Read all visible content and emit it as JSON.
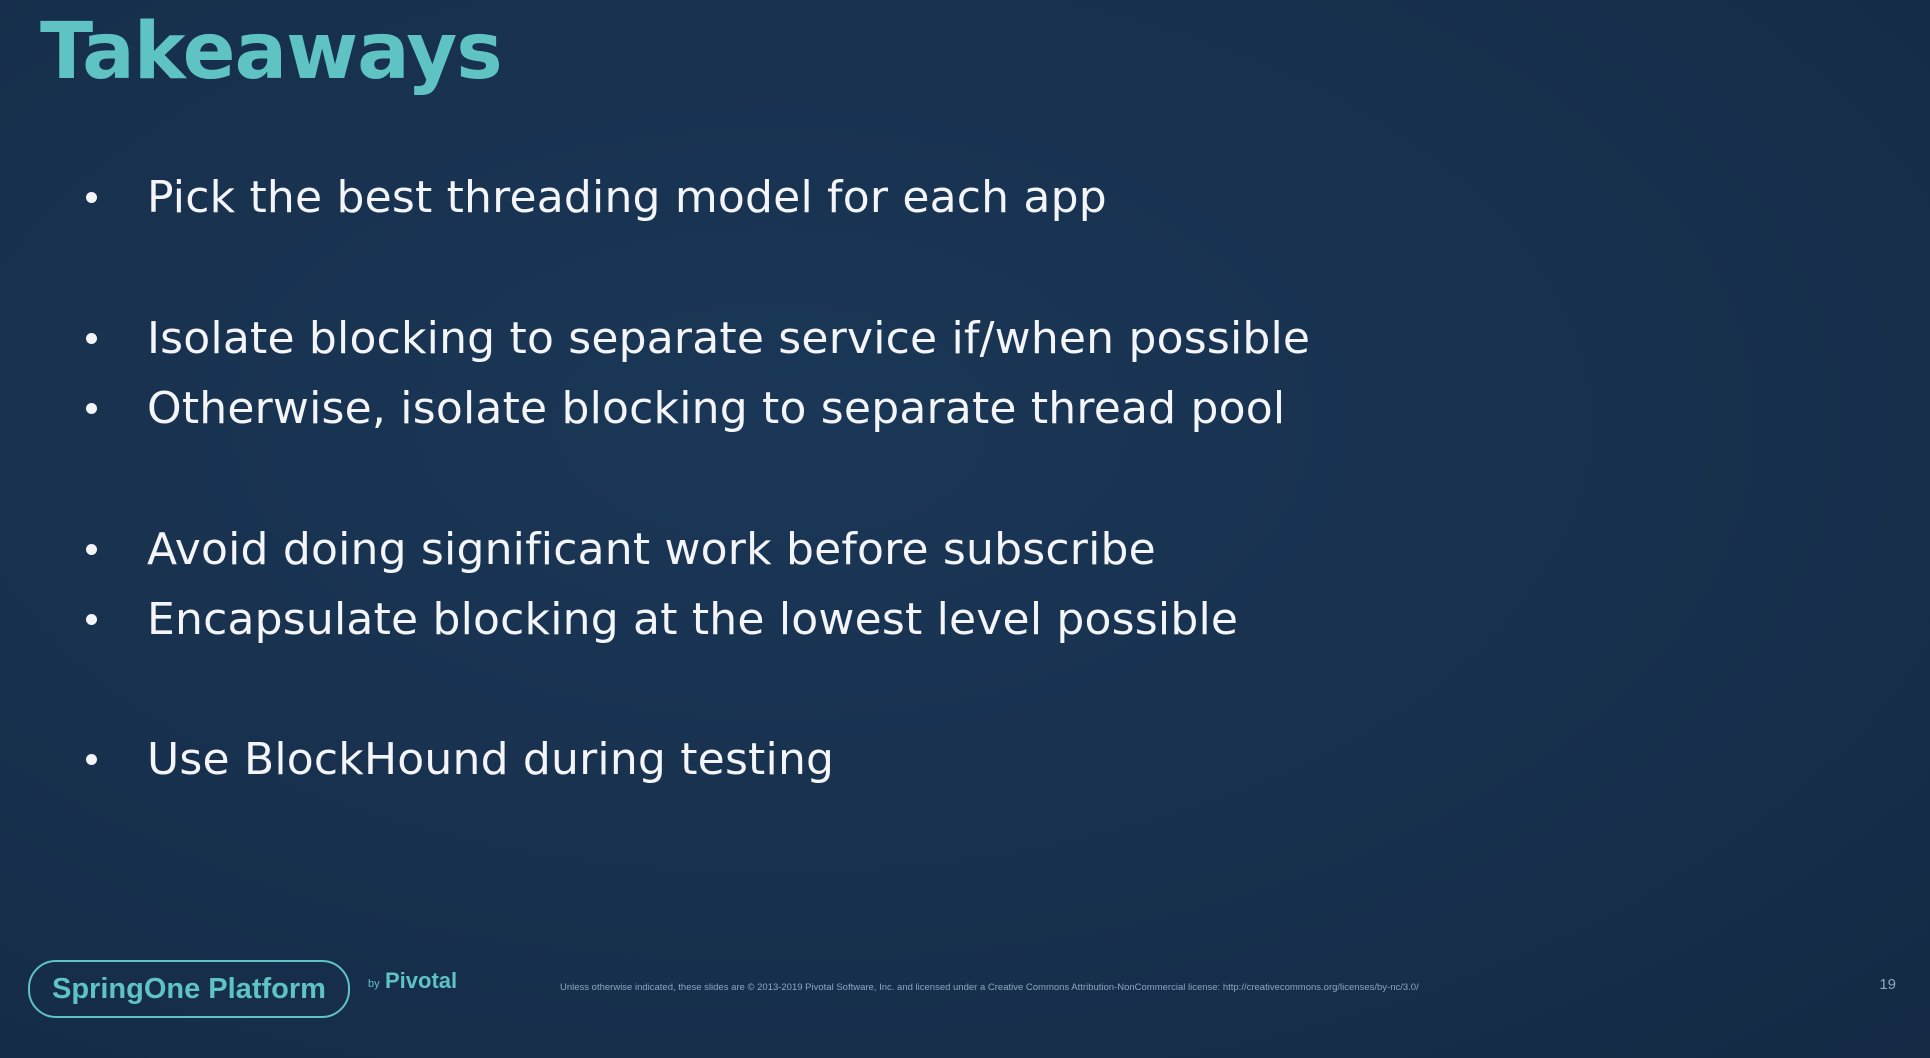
{
  "slide": {
    "title": "Takeaways",
    "bullets": [
      "Pick the best threading model for each app",
      "Isolate blocking to separate service if/when possible",
      "Otherwise, isolate blocking to separate thread pool",
      "Avoid doing significant work before subscribe",
      "Encapsulate blocking at the lowest level possible",
      "Use BlockHound during testing"
    ]
  },
  "footer": {
    "brand": "SpringOne Platform",
    "by": "by",
    "company": "Pivotal",
    "legal": "Unless otherwise indicated, these slides are © 2013-2019 Pivotal Software, Inc. and licensed under a Creative Commons Attribution-NonCommercial license: http://creativecommons.org/licenses/by-nc/3.0/",
    "page_number": "19"
  },
  "colors": {
    "background": "#17314e",
    "accent": "#5ec3c2",
    "text": "#f3f5f8"
  }
}
